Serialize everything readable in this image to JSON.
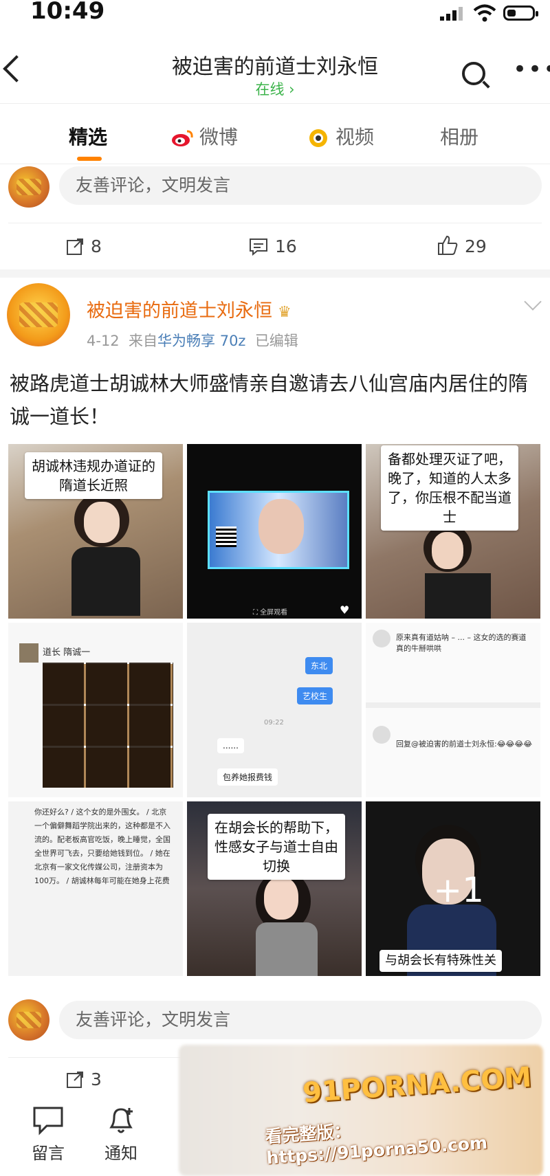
{
  "status_bar": {
    "time": "10:49"
  },
  "header": {
    "title": "被迫害的前道士刘永恒",
    "subtitle": "在线 ›"
  },
  "tabs": [
    {
      "label": "精选",
      "active": true
    },
    {
      "label": "微博",
      "icon": "weibo-icon"
    },
    {
      "label": "视频",
      "icon": "video-icon"
    },
    {
      "label": "相册"
    }
  ],
  "comment_placeholder": "友善评论，文明发言",
  "prev_post_stats": {
    "repost": "8",
    "comment": "16",
    "like": "29"
  },
  "post": {
    "author": "被迫害的前道士刘永恒",
    "date": "4-12",
    "from_prefix": "来自",
    "device": "华为畅享 70z",
    "edited": "已编辑",
    "text": "被路虎道士胡诚林大师盛情亲自邀请去八仙宫庙内居住的隋诚一道长！",
    "images": [
      {
        "caption": "胡诚林违规办道证的\n隋道长近照"
      },
      {
        "caption": ""
      },
      {
        "caption": "备都处理灭证了吧，\n晚了，知道的人太多\n了，你压根不配当道\n士"
      },
      {
        "caption": "道长 隋诚一"
      },
      {
        "caption": "东北 / 艺校生 / ...... / 包养她报费钱"
      },
      {
        "caption": "原来真有道姑呐 – ... – 这女的选的赛道真的牛掰哄哄"
      },
      {
        "caption": "你还好么? / 这个女的是外围女。 / 北京一个偏僻舞蹈学院出来的，这种都是不入流的。配老板高官吃饭，晚上睡觉，全国全世界可飞去，只要给她钱到位。 / 她在北京有一家文化传媒公司，注册资本为100万。 / 胡诚林每年可能在她身上花费"
      },
      {
        "caption": "在胡会长的帮助下，\n性感女子与道士自由\n切换"
      },
      {
        "caption": "与胡会长有特殊性关",
        "more": "+1"
      }
    ],
    "stats": {
      "repost": "3"
    }
  },
  "bottom_nav": [
    {
      "label": "留言",
      "icon": "message-icon"
    },
    {
      "label": "通知",
      "icon": "bell-icon"
    }
  ],
  "watermark": {
    "line1": "91PORNA.COM",
    "line2": "看完整版：https://91porna50.com"
  }
}
